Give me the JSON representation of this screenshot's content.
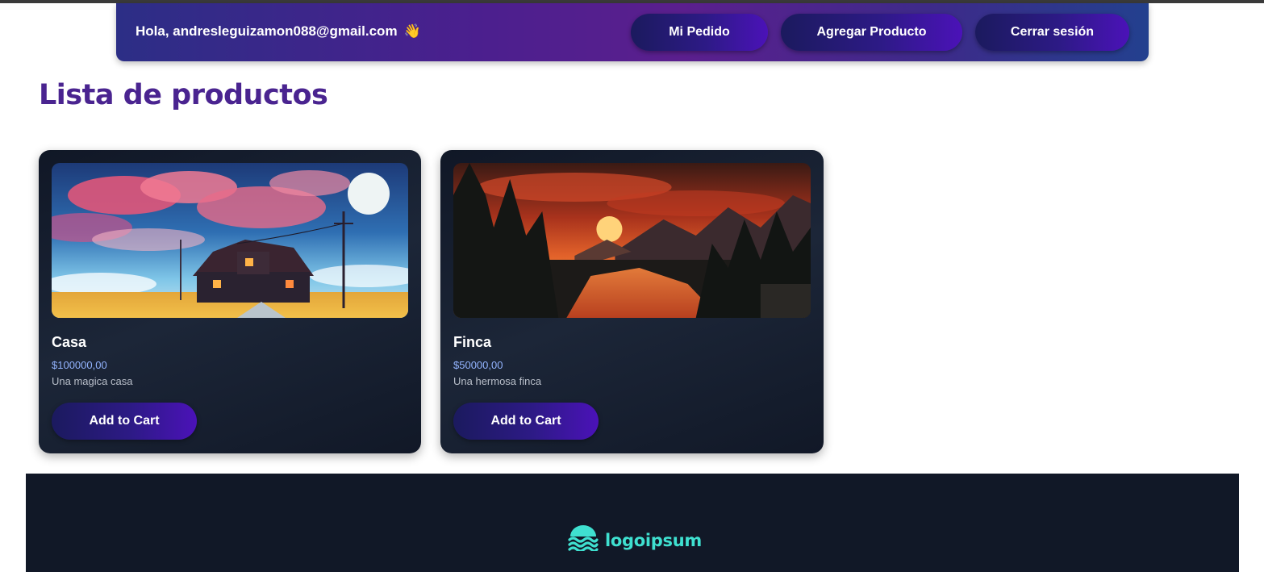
{
  "header": {
    "greeting": "Hola, andresleguizamon088@gmail.com",
    "wave_emoji": "👋",
    "buttons": {
      "mi_pedido": "Mi Pedido",
      "agregar_producto": "Agregar Producto",
      "cerrar_sesion": "Cerrar sesión"
    }
  },
  "main": {
    "title": "Lista de productos",
    "products": [
      {
        "name": "Casa",
        "price": "$100000,00",
        "description": "Una magica casa",
        "button": "Add to Cart",
        "image_icon": "pixel-art-house-image"
      },
      {
        "name": "Finca",
        "price": "$50000,00",
        "description": "Una hermosa finca",
        "button": "Add to Cart",
        "image_icon": "pixel-art-forest-river-image"
      }
    ]
  },
  "footer": {
    "logo_text": "logoipsum",
    "logo_icon": "waves-logo-icon"
  },
  "colors": {
    "title": "#4a2490",
    "accent_button": "#4b12b8",
    "card_bg": "#111827",
    "price": "#93b4ff",
    "logo": "#3fe0d0"
  }
}
